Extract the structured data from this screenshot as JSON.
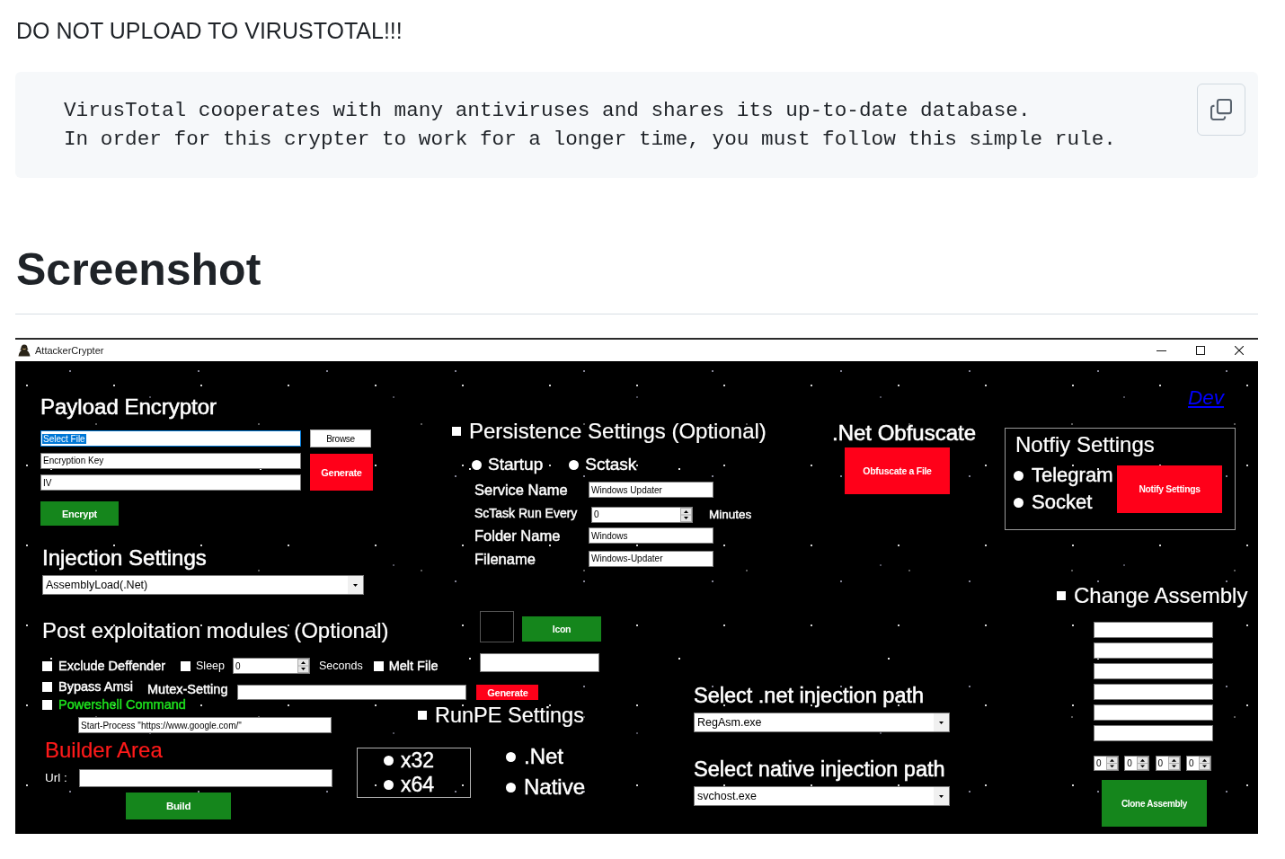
{
  "readme": {
    "notice": "DO NOT UPLOAD TO VIRUSTOTAL!!!",
    "code_lines": [
      "VirusTotal cooperates with many antiviruses and shares its up-to-date database.",
      "In order for this crypter to work for a longer time, you must follow this simple rule."
    ],
    "heading": "Screenshot"
  },
  "window": {
    "title": "AttackerCrypter",
    "payload_encryptor": {
      "title": "Payload Encryptor",
      "fields": [
        {
          "value": "Select File",
          "text_selected": true
        },
        {
          "value": "Encryption Key",
          "text_selected": false
        },
        {
          "value": "IV",
          "text_selected": false
        }
      ],
      "browse_button": "Browse",
      "generate_button": "Generate",
      "encrypt_button": "Encrypt"
    },
    "dev_link": "Dev",
    "persistence": {
      "title": "Persistence Settings (Optional)",
      "checked": false,
      "methods": [
        {
          "label": "Startup",
          "selected": false
        },
        {
          "label": "Sctask",
          "selected": false
        }
      ],
      "fields": [
        {
          "kind": "text",
          "label": "Service Name",
          "value": "Windows Updater"
        },
        {
          "kind": "spinner",
          "label": "ScTask Run Every",
          "value": "0",
          "unit": "Minutes"
        },
        {
          "kind": "text",
          "label": "Folder Name",
          "value": "Windows"
        },
        {
          "kind": "text",
          "label": "Filename",
          "value": "Windows-Updater"
        }
      ]
    },
    "obfuscate": {
      "title": ".Net Obfuscate",
      "button": "Obfuscate a File"
    },
    "notify": {
      "title": "Notfiy Settings",
      "channels": [
        {
          "label": "Telegram",
          "selected": false
        },
        {
          "label": "Socket",
          "selected": false
        }
      ],
      "button": "Notify Settings"
    },
    "injection_settings": {
      "title": "Injection Settings",
      "value": "AssemblyLoad(.Net)"
    },
    "change_assembly": {
      "title": "Change Assembly",
      "checked": false,
      "version": [
        "0",
        "0",
        "0",
        "0"
      ],
      "button": "Clone Assembly"
    },
    "post_exploitation": {
      "title": "Post exploitation modules (Optional)",
      "exclude_defender": {
        "label": "Exclude Deffender",
        "checked": false
      },
      "sleep": {
        "label": "Sleep",
        "checked": false,
        "value": "0",
        "unit": "Seconds"
      },
      "melt_file": {
        "label": "Melt File",
        "checked": false
      },
      "bypass_amsi": {
        "label": "Bypass Amsi",
        "checked": false
      },
      "mutex": {
        "label": "Mutex-Setting",
        "generate_button": "Generate"
      },
      "powershell": {
        "label": "Powershell Command",
        "checked": false,
        "command": "Start-Process \"https://www.google.com/\""
      }
    },
    "icon": {
      "button": "Icon"
    },
    "runpe": {
      "title": "RunPE Settings",
      "checked": false,
      "architectures": [
        {
          "label": "x32",
          "selected": false
        },
        {
          "label": "x64",
          "selected": false
        }
      ],
      "targets": [
        {
          "label": ".Net",
          "selected": false
        },
        {
          "label": "Native",
          "selected": false
        }
      ]
    },
    "injection_paths": [
      {
        "title": "Select .net injection path",
        "value": "RegAsm.exe"
      },
      {
        "title": "Select native injection path",
        "value": "svchost.exe"
      }
    ],
    "builder": {
      "title": "Builder Area",
      "url_label": "Url :",
      "build_button": "Build"
    }
  }
}
